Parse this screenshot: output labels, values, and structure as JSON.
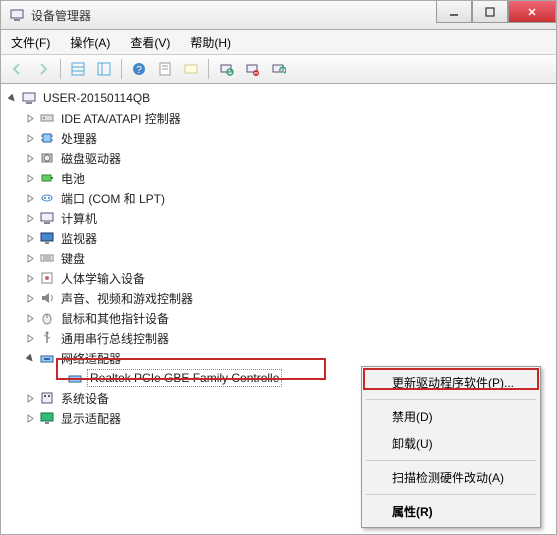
{
  "window": {
    "title": "设备管理器"
  },
  "menu": {
    "file": "文件(F)",
    "action": "操作(A)",
    "view": "查看(V)",
    "help": "帮助(H)"
  },
  "tree": {
    "root": "USER-20150114QB",
    "items": [
      "IDE ATA/ATAPI 控制器",
      "处理器",
      "磁盘驱动器",
      "电池",
      "端口 (COM 和 LPT)",
      "计算机",
      "监视器",
      "键盘",
      "人体学输入设备",
      "声音、视频和游戏控制器",
      "鼠标和其他指针设备",
      "通用串行总线控制器",
      "网络适配器",
      "系统设备",
      "显示适配器"
    ],
    "network_child": "Realtek PCIe GBE Family Controlle"
  },
  "context_menu": {
    "update": "更新驱动程序软件(P)...",
    "disable": "禁用(D)",
    "uninstall": "卸载(U)",
    "scan": "扫描检测硬件改动(A)",
    "properties": "属性(R)"
  }
}
